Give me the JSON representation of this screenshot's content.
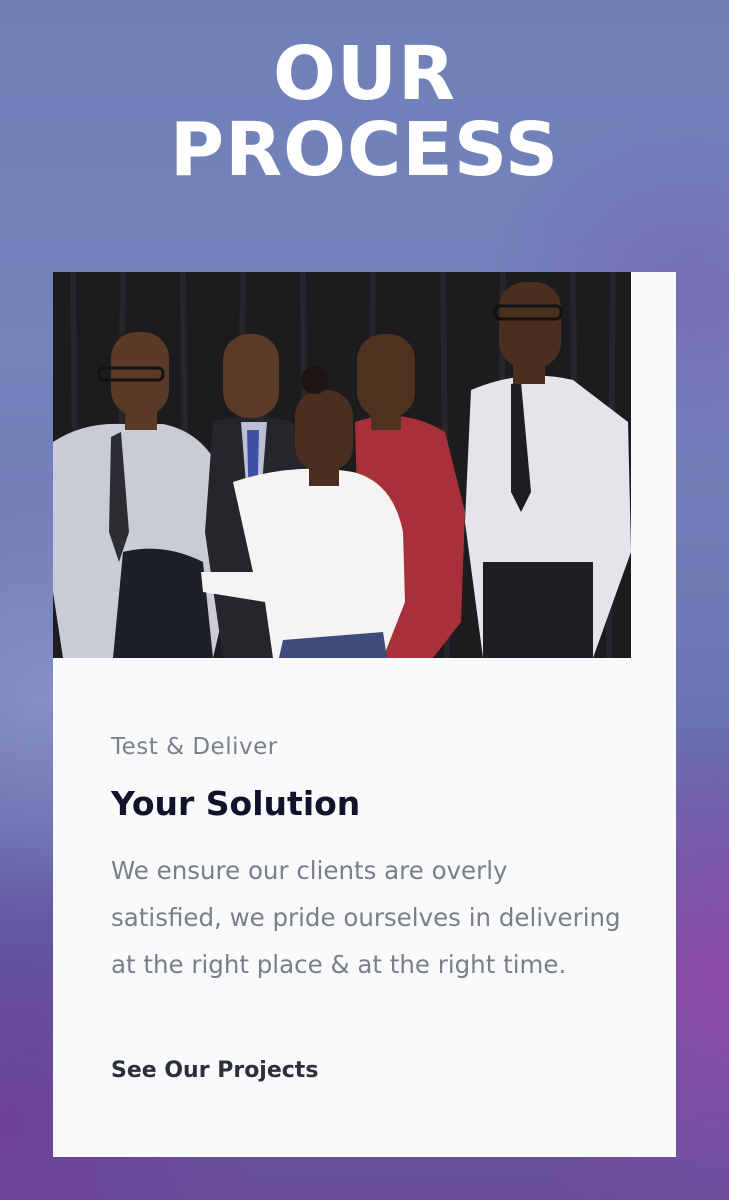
{
  "hero": {
    "title_line1": "OUR",
    "title_line2": "PROCESS"
  },
  "card": {
    "image_alt": "Team of five people posing in front of a black curtain",
    "eyebrow": "Test & Deliver",
    "title": "Your Solution",
    "body": "We ensure our clients are overly satisfied, we pride ourselves in delivering at the right place & at the right time.",
    "cta_label": "See Our Projects"
  },
  "colors": {
    "background_top": "#6f7fb8",
    "background_bottom": "#6a4f9a",
    "card_background": "#f9fafc",
    "title_text": "#12132b",
    "muted_text": "#7a7f86"
  }
}
